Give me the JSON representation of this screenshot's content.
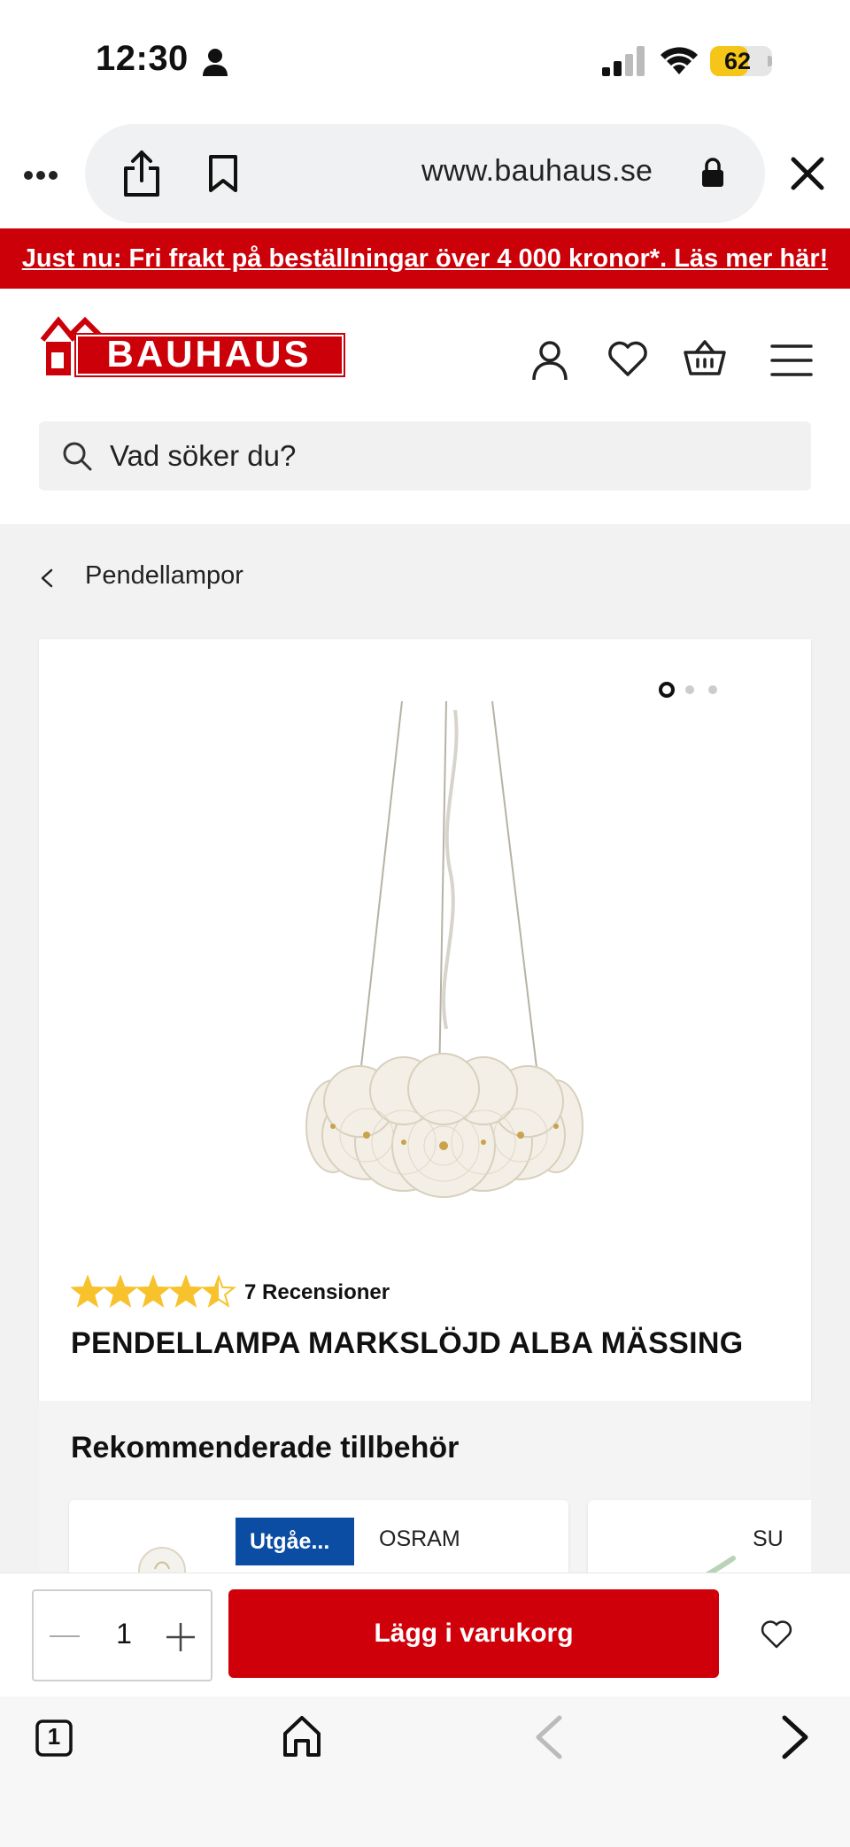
{
  "status_bar": {
    "time": "12:30",
    "battery": "62",
    "battery_level": 0.62,
    "icons": [
      "person-icon",
      "signal-icon",
      "wifi-icon",
      "battery-icon"
    ]
  },
  "browser": {
    "url": "www.bauhaus.se",
    "icons": [
      "more-icon",
      "share-icon",
      "bookmark-icon",
      "lock-icon",
      "close-icon"
    ]
  },
  "promo": {
    "text": "Just nu: Fri frakt på beställningar över 4 000 kronor*. Läs mer här!"
  },
  "header": {
    "logo_text": "BAUHAUS",
    "icons": [
      "account-icon",
      "heart-icon",
      "basket-icon",
      "menu-icon"
    ],
    "search_placeholder": "Vad söker du?"
  },
  "breadcrumb": {
    "label": "Pendellampor"
  },
  "product": {
    "image_dots": {
      "count": 3,
      "active_index": 0
    },
    "rating": 4.5,
    "rating_max": 5,
    "review_count": "7 Recensioner",
    "title": "PENDELLAMPA MARKSLÖJD ALBA MÄSSING"
  },
  "accessories": {
    "title": "Rekommenderade tillbehör",
    "items": [
      {
        "badge": "Utgåe...",
        "brand": "OSRAM"
      },
      {
        "brand": "SU"
      }
    ]
  },
  "purchase_bar": {
    "quantity": "1",
    "add_to_cart_label": "Lägg i varukorg"
  },
  "toolbar": {
    "tabs_count": "1",
    "icons": [
      "tabs-icon",
      "home-icon",
      "back-icon",
      "forward-icon"
    ]
  },
  "colors": {
    "brand_red": "#cc0008",
    "badge_blue": "#0b4da2",
    "star_yellow": "#f7c22c",
    "battery_yellow": "#f5c518"
  }
}
